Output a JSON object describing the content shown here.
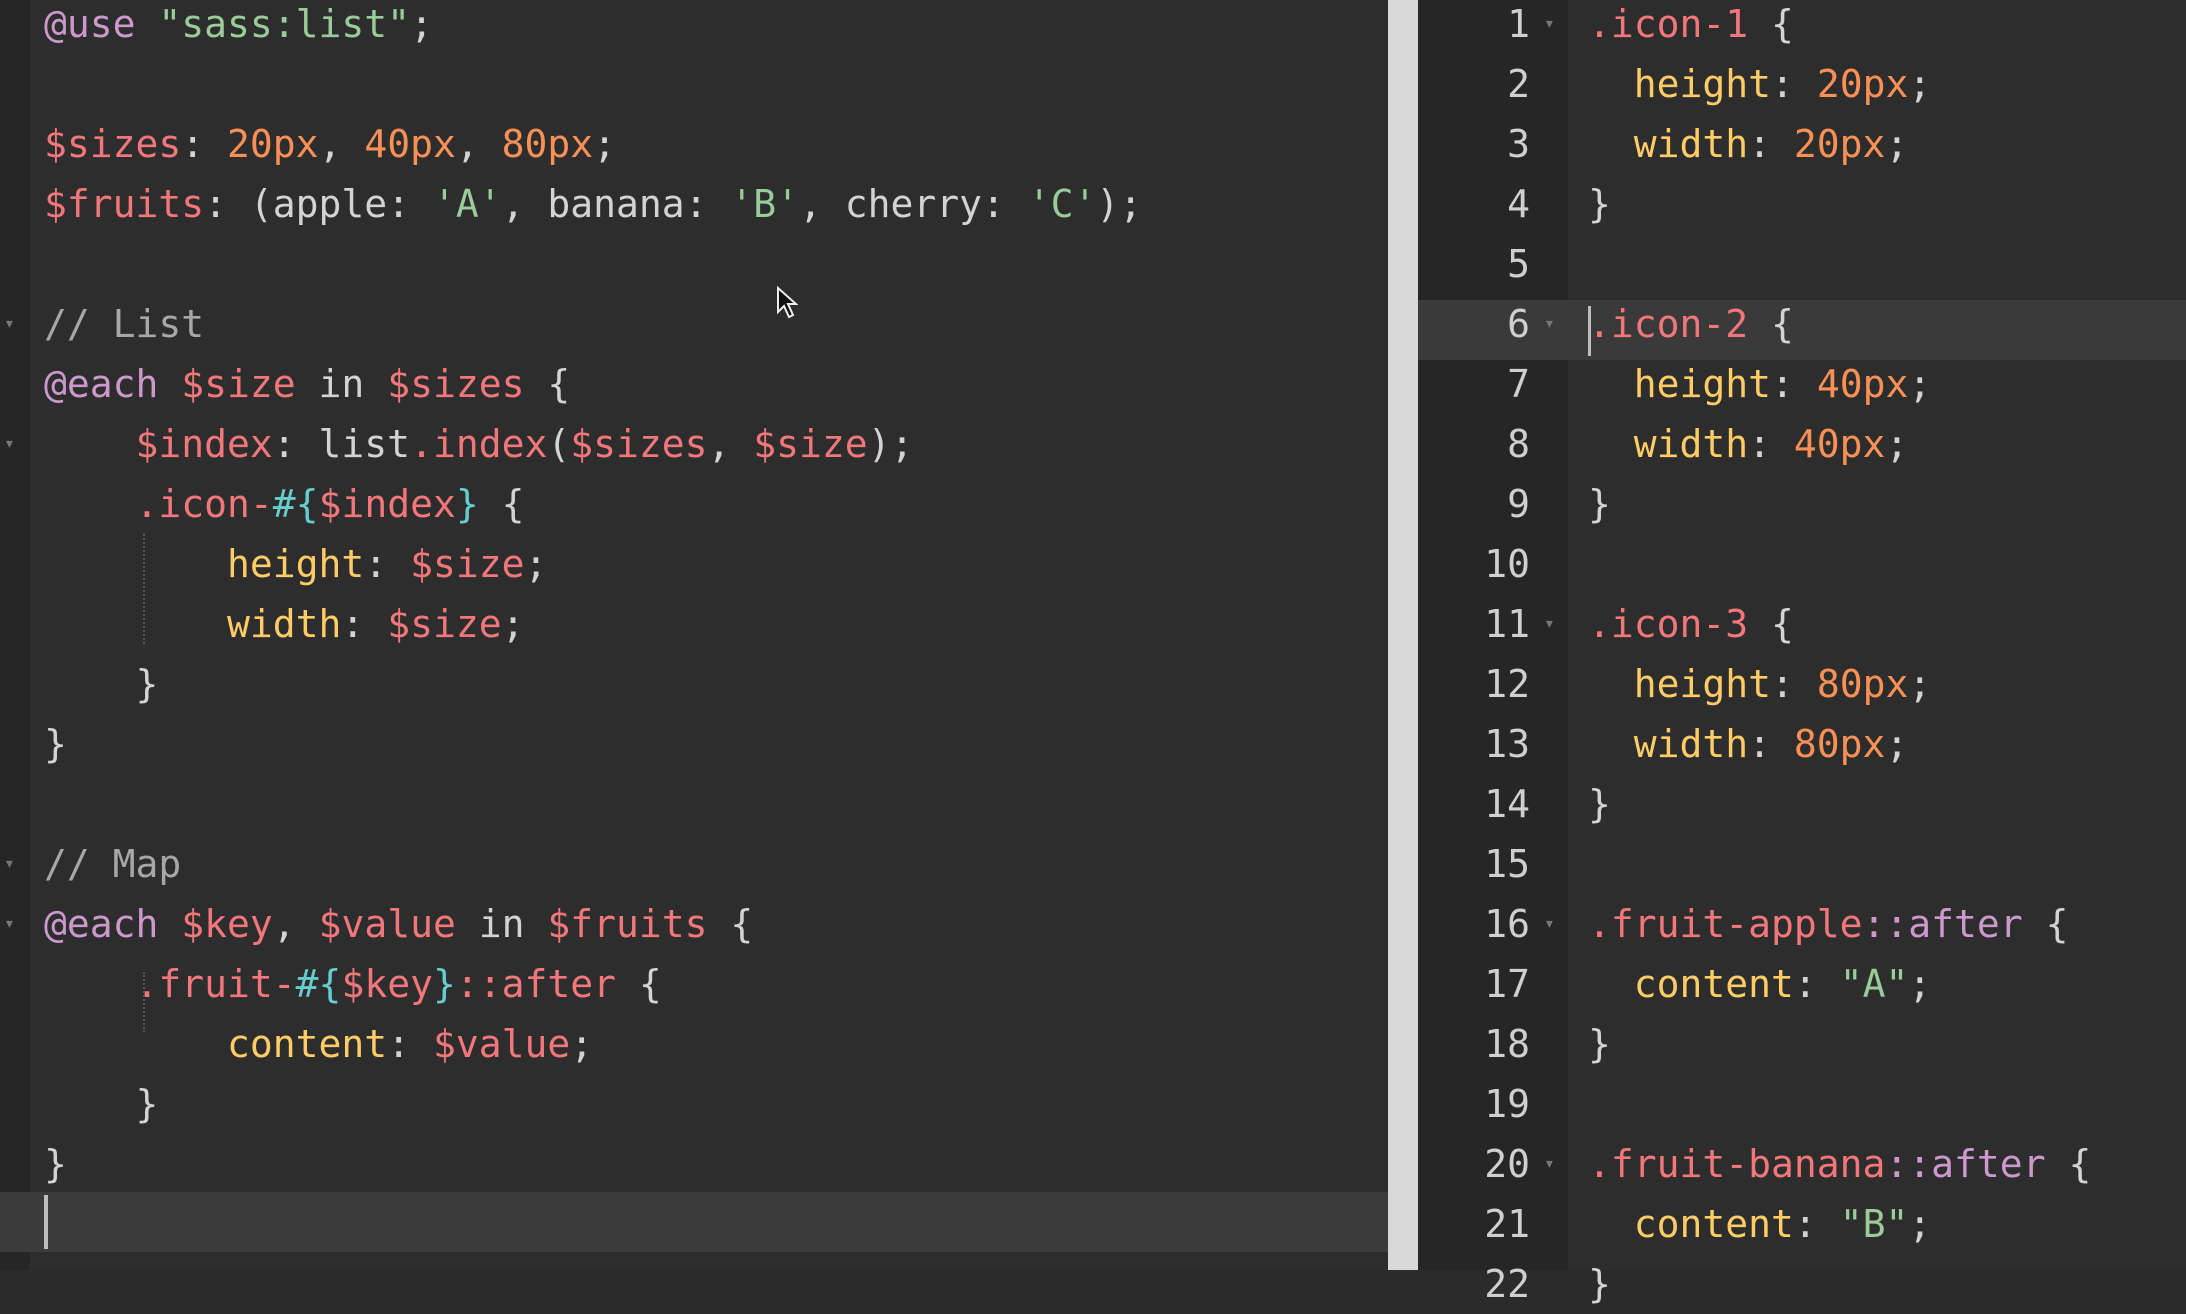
{
  "left_editor": {
    "lines": [
      [
        [
          "tok-at",
          "@use "
        ],
        [
          "tok-str",
          "\"sass:list\""
        ],
        [
          "tok-plain",
          ";"
        ]
      ],
      [],
      [
        [
          "tok-var",
          "$sizes"
        ],
        [
          "tok-plain",
          ": "
        ],
        [
          "tok-num",
          "20px"
        ],
        [
          "tok-plain",
          ", "
        ],
        [
          "tok-num",
          "40px"
        ],
        [
          "tok-plain",
          ", "
        ],
        [
          "tok-num",
          "80px"
        ],
        [
          "tok-plain",
          ";"
        ]
      ],
      [
        [
          "tok-var",
          "$fruits"
        ],
        [
          "tok-plain",
          ": (apple: "
        ],
        [
          "tok-str",
          "'A'"
        ],
        [
          "tok-plain",
          ", banana: "
        ],
        [
          "tok-str",
          "'B'"
        ],
        [
          "tok-plain",
          ", cherry: "
        ],
        [
          "tok-str",
          "'C'"
        ],
        [
          "tok-plain",
          ");"
        ]
      ],
      [],
      [
        [
          "tok-com",
          "// List"
        ]
      ],
      [
        [
          "tok-at",
          "@each "
        ],
        [
          "tok-var",
          "$size"
        ],
        [
          "tok-plain",
          " in "
        ],
        [
          "tok-var",
          "$sizes"
        ],
        [
          "tok-plain",
          " {"
        ]
      ],
      [
        [
          "tok-plain",
          "    "
        ],
        [
          "tok-var",
          "$index"
        ],
        [
          "tok-plain",
          ": list"
        ],
        [
          "tok-func",
          ".index"
        ],
        [
          "tok-plain",
          "("
        ],
        [
          "tok-var",
          "$sizes"
        ],
        [
          "tok-plain",
          ", "
        ],
        [
          "tok-var",
          "$size"
        ],
        [
          "tok-plain",
          ");"
        ]
      ],
      [
        [
          "tok-plain",
          "    "
        ],
        [
          "tok-sel",
          ".icon-"
        ],
        [
          "tok-interp",
          "#{"
        ],
        [
          "tok-var",
          "$index"
        ],
        [
          "tok-interp",
          "}"
        ],
        [
          "tok-plain",
          " {"
        ]
      ],
      [
        [
          "tok-plain",
          "        "
        ],
        [
          "tok-prop",
          "height"
        ],
        [
          "tok-plain",
          ": "
        ],
        [
          "tok-var",
          "$size"
        ],
        [
          "tok-plain",
          ";"
        ]
      ],
      [
        [
          "tok-plain",
          "        "
        ],
        [
          "tok-prop",
          "width"
        ],
        [
          "tok-plain",
          ": "
        ],
        [
          "tok-var",
          "$size"
        ],
        [
          "tok-plain",
          ";"
        ]
      ],
      [
        [
          "tok-plain",
          "    }"
        ]
      ],
      [
        [
          "tok-plain",
          "}"
        ]
      ],
      [],
      [
        [
          "tok-com",
          "// Map"
        ]
      ],
      [
        [
          "tok-at",
          "@each "
        ],
        [
          "tok-var",
          "$key"
        ],
        [
          "tok-plain",
          ", "
        ],
        [
          "tok-var",
          "$value"
        ],
        [
          "tok-plain",
          " in "
        ],
        [
          "tok-var",
          "$fruits"
        ],
        [
          "tok-plain",
          " {"
        ]
      ],
      [
        [
          "tok-plain",
          "    "
        ],
        [
          "tok-sel",
          ".fruit-"
        ],
        [
          "tok-interp",
          "#{"
        ],
        [
          "tok-var",
          "$key"
        ],
        [
          "tok-interp",
          "}"
        ],
        [
          "tok-sel",
          "::after"
        ],
        [
          "tok-plain",
          " {"
        ]
      ],
      [
        [
          "tok-plain",
          "        "
        ],
        [
          "tok-prop",
          "content"
        ],
        [
          "tok-plain",
          ": "
        ],
        [
          "tok-var",
          "$value"
        ],
        [
          "tok-plain",
          ";"
        ]
      ],
      [
        [
          "tok-plain",
          "    }"
        ]
      ],
      [
        [
          "tok-plain",
          "}"
        ]
      ]
    ],
    "fold_lines": [
      6,
      8,
      15,
      16
    ]
  },
  "right_editor": {
    "line_numbers": [
      "1",
      "2",
      "3",
      "4",
      "5",
      "6",
      "7",
      "8",
      "9",
      "10",
      "11",
      "12",
      "13",
      "14",
      "15",
      "16",
      "17",
      "18",
      "19",
      "20",
      "21",
      "22"
    ],
    "active_line": 6,
    "fold_lines": [
      1,
      6,
      11,
      16,
      20
    ],
    "lines": [
      [
        [
          "tok-sel",
          ".icon-1"
        ],
        [
          "tok-plain",
          " {"
        ]
      ],
      [
        [
          "tok-plain",
          "  "
        ],
        [
          "tok-prop",
          "height"
        ],
        [
          "tok-plain",
          ": "
        ],
        [
          "tok-num",
          "20px"
        ],
        [
          "tok-plain",
          ";"
        ]
      ],
      [
        [
          "tok-plain",
          "  "
        ],
        [
          "tok-prop",
          "width"
        ],
        [
          "tok-plain",
          ": "
        ],
        [
          "tok-num",
          "20px"
        ],
        [
          "tok-plain",
          ";"
        ]
      ],
      [
        [
          "tok-plain",
          "}"
        ]
      ],
      [],
      [
        [
          "tok-sel",
          ".icon-2"
        ],
        [
          "tok-plain",
          " {"
        ]
      ],
      [
        [
          "tok-plain",
          "  "
        ],
        [
          "tok-prop",
          "height"
        ],
        [
          "tok-plain",
          ": "
        ],
        [
          "tok-num",
          "40px"
        ],
        [
          "tok-plain",
          ";"
        ]
      ],
      [
        [
          "tok-plain",
          "  "
        ],
        [
          "tok-prop",
          "width"
        ],
        [
          "tok-plain",
          ": "
        ],
        [
          "tok-num",
          "40px"
        ],
        [
          "tok-plain",
          ";"
        ]
      ],
      [
        [
          "tok-plain",
          "}"
        ]
      ],
      [],
      [
        [
          "tok-sel",
          ".icon-3"
        ],
        [
          "tok-plain",
          " {"
        ]
      ],
      [
        [
          "tok-plain",
          "  "
        ],
        [
          "tok-prop",
          "height"
        ],
        [
          "tok-plain",
          ": "
        ],
        [
          "tok-num",
          "80px"
        ],
        [
          "tok-plain",
          ";"
        ]
      ],
      [
        [
          "tok-plain",
          "  "
        ],
        [
          "tok-prop",
          "width"
        ],
        [
          "tok-plain",
          ": "
        ],
        [
          "tok-num",
          "80px"
        ],
        [
          "tok-plain",
          ";"
        ]
      ],
      [
        [
          "tok-plain",
          "}"
        ]
      ],
      [],
      [
        [
          "tok-sel",
          ".fruit-apple"
        ],
        [
          "tok-at",
          "::after"
        ],
        [
          "tok-plain",
          " {"
        ]
      ],
      [
        [
          "tok-plain",
          "  "
        ],
        [
          "tok-prop",
          "content"
        ],
        [
          "tok-plain",
          ": "
        ],
        [
          "tok-str",
          "\"A\""
        ],
        [
          "tok-plain",
          ";"
        ]
      ],
      [
        [
          "tok-plain",
          "}"
        ]
      ],
      [],
      [
        [
          "tok-sel",
          ".fruit-banana"
        ],
        [
          "tok-at",
          "::after"
        ],
        [
          "tok-plain",
          " {"
        ]
      ],
      [
        [
          "tok-plain",
          "  "
        ],
        [
          "tok-prop",
          "content"
        ],
        [
          "tok-plain",
          ": "
        ],
        [
          "tok-str",
          "\"B\""
        ],
        [
          "tok-plain",
          ";"
        ]
      ],
      [
        [
          "tok-plain",
          "}"
        ]
      ]
    ]
  }
}
